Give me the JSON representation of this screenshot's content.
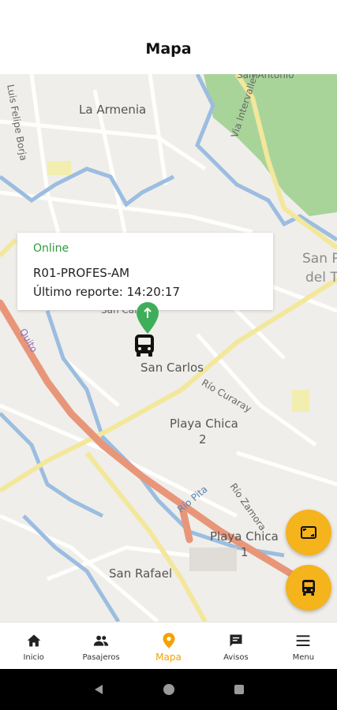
{
  "header": {
    "title": "Mapa"
  },
  "map": {
    "labels": {
      "la_armenia": "La Armenia",
      "luis_felipe_borja": "Luis Felipe Borja",
      "san_carlos": "San Carlos",
      "san_carlos_partial": "San Carl",
      "playa_chica_2": "Playa Chica\n2",
      "playa_chica_2_name": "Playa Chica",
      "playa_chica_2_num": "2",
      "rio_curaray": "Río Curaray",
      "rio_pita": "Río Pita",
      "rio_zamora": "Río Zamora",
      "playa_chica_1_name": "Playa Chica",
      "playa_chica_1_num": "1",
      "san_rafael": "San Rafael",
      "san_pedro_partial_1": "San P",
      "san_pedro_partial_2": "del T",
      "via_intervalles": "Via Intervalles",
      "quito": "Quito",
      "san_antonio_partial": "San Antonio"
    },
    "colors": {
      "road_primary": "#e8967a",
      "road_secondary": "#f3e79b",
      "river": "#9bbde0",
      "park": "#a8d49a"
    }
  },
  "info_popup": {
    "status": "Online",
    "route": "R01-PROFES-AM",
    "last_report": "Último reporte: 14:20:17"
  },
  "fabs": [
    {
      "icon": "fullscreen-icon"
    },
    {
      "icon": "bus-icon"
    }
  ],
  "tabbar": {
    "items": [
      {
        "label": "Inicio",
        "icon": "home-icon"
      },
      {
        "label": "Pasajeros",
        "icon": "people-icon"
      },
      {
        "label": "Mapa",
        "icon": "location-pin-icon"
      },
      {
        "label": "Avisos",
        "icon": "message-icon"
      },
      {
        "label": "Menu",
        "icon": "menu-icon"
      }
    ],
    "active": "Mapa",
    "accent": "#f5a200"
  }
}
